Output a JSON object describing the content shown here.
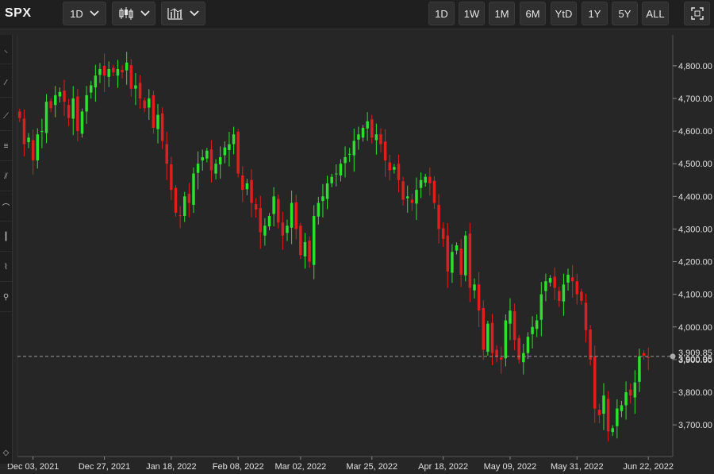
{
  "header": {
    "symbol": "SPX",
    "interval": "1D",
    "ranges": [
      "1D",
      "1W",
      "1M",
      "6M",
      "YtD",
      "1Y",
      "5Y",
      "ALL"
    ]
  },
  "icons": {
    "interval_dropdown": "chevron-down-icon",
    "chart_type": "candlestick-icon",
    "indicators": "indicators-icon",
    "fullscreen": "fullscreen-icon",
    "left_tools": [
      "pin-tool-icon",
      "line-tool-icon",
      "trend-tool-icon",
      "fib-tool-icon",
      "channel-tool-icon",
      "arc-tool-icon",
      "ruler-tool-icon",
      "pattern-tool-icon",
      "note-tool-icon",
      "collapse-icon"
    ]
  },
  "colors": {
    "up": "#2ee02e",
    "down": "#e01e1e",
    "background": "#262626",
    "grid": "#3a3a3a",
    "last_price_line": "#9a9a9a"
  },
  "chart_data": {
    "type": "candlestick",
    "title": "",
    "xlabel": "",
    "ylabel": "",
    "ylim": [
      3620,
      4880
    ],
    "yticks": [
      3700,
      3800,
      3900,
      4000,
      4100,
      4200,
      4300,
      4400,
      4500,
      4600,
      4700,
      4800
    ],
    "ytick_labels": [
      "3,700.00",
      "3,800.00",
      "3,900.00",
      "4,000.00",
      "4,100.00",
      "4,200.00",
      "4,300.00",
      "4,400.00",
      "4,500.00",
      "4,600.00",
      "4,700.00",
      "4,800.00"
    ],
    "xtick_labels": [
      "Dec 03, 2021",
      "Dec 27, 2021",
      "Jan 18, 2022",
      "Feb 08, 2022",
      "Mar 02, 2022",
      "Mar 25, 2022",
      "Apr 18, 2022",
      "May 09, 2022",
      "May 31, 2022",
      "Jun 22, 2022"
    ],
    "xtick_index": [
      3,
      19,
      34,
      49,
      63,
      79,
      95,
      110,
      125,
      141
    ],
    "last_price": 3909.85,
    "last_price_label": "3,909.85",
    "current_level": 3900.95,
    "current_level_label": "3,900.95",
    "closes": [
      4640,
      4560,
      4580,
      4510,
      4590,
      4600,
      4690,
      4670,
      4710,
      4720,
      4690,
      4640,
      4700,
      4600,
      4660,
      4710,
      4740,
      4770,
      4790,
      4770,
      4790,
      4780,
      4790,
      4780,
      4810,
      4730,
      4740,
      4700,
      4670,
      4700,
      4610,
      4650,
      4570,
      4500,
      4420,
      4350,
      4340,
      4400,
      4380,
      4470,
      4500,
      4520,
      4540,
      4480,
      4500,
      4520,
      4550,
      4560,
      4590,
      4470,
      4420,
      4440,
      4380,
      4360,
      4290,
      4310,
      4340,
      4400,
      4320,
      4280,
      4310,
      4380,
      4300,
      4220,
      4260,
      4200,
      4340,
      4380,
      4400,
      4440,
      4460,
      4470,
      4500,
      4520,
      4530,
      4570,
      4590,
      4610,
      4630,
      4580,
      4590,
      4560,
      4510,
      4480,
      4490,
      4450,
      4390,
      4400,
      4380,
      4420,
      4450,
      4460,
      4440,
      4380,
      4300,
      4270,
      4170,
      4230,
      4250,
      4160,
      4280,
      4120,
      4130,
      4050,
      3930,
      4010,
      3920,
      3910,
      3900,
      4020,
      4050,
      3960,
      3900,
      3920,
      3970,
      4000,
      4020,
      4100,
      4140,
      4150,
      4120,
      4080,
      4130,
      4160,
      4140,
      4100,
      4080,
      3990,
      3900,
      3750,
      3730,
      3790,
      3680,
      3690,
      3750,
      3760,
      3800,
      3790,
      3830,
      3910,
      3912,
      3905
    ]
  }
}
